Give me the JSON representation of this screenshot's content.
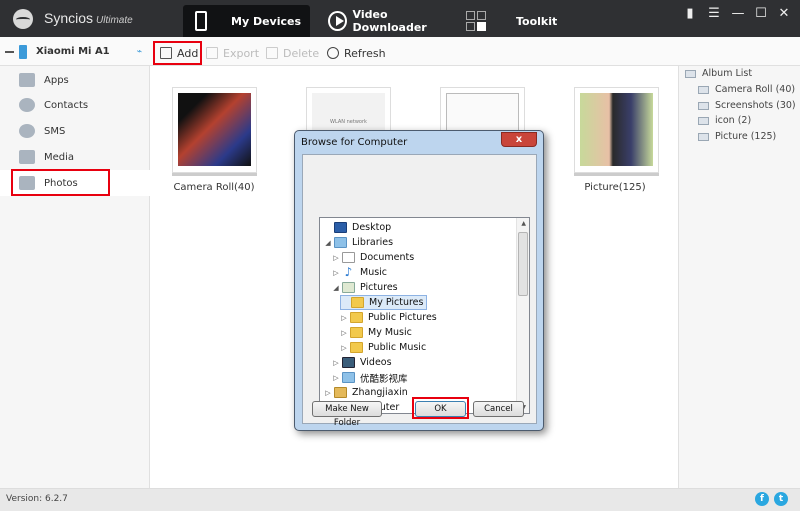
{
  "app": {
    "name": "Syncios",
    "edition": "Ultimate"
  },
  "nav_tabs": [
    {
      "label": "My Devices",
      "icon": "phone-icon",
      "active": true
    },
    {
      "label": "Video Downloader",
      "icon": "play-icon",
      "active": false
    },
    {
      "label": "Toolkit",
      "icon": "toolkit-grid-icon",
      "active": false
    }
  ],
  "window_controls": {
    "feedback": "▮",
    "menu": "☰",
    "minimize": "—",
    "maximize": "☐",
    "close": "✕"
  },
  "device": {
    "name": "Xiaomi Mi A1",
    "usb_icon": "⌁"
  },
  "toolbar": {
    "add": "Add",
    "export": "Export",
    "delete": "Delete",
    "refresh": "Refresh"
  },
  "sidebar": {
    "items": [
      {
        "label": "Apps",
        "icon": "apps-icon"
      },
      {
        "label": "Contacts",
        "icon": "contacts-icon"
      },
      {
        "label": "SMS",
        "icon": "sms-icon"
      },
      {
        "label": "Media",
        "icon": "media-icon"
      },
      {
        "label": "Photos",
        "icon": "photos-icon",
        "active": true
      }
    ]
  },
  "albums": [
    {
      "label": "Camera Roll(40)"
    },
    {
      "label": ""
    },
    {
      "label": ""
    },
    {
      "label": "Picture(125)"
    }
  ],
  "album_thumb_text": {
    "wlan": "WLAN network"
  },
  "album_list": {
    "title": "Album List",
    "items": [
      "Camera Roll (40)",
      "Screenshots (30)",
      "icon (2)",
      "Picture (125)"
    ]
  },
  "dialog": {
    "title": "Browse for Computer",
    "close": "x",
    "tree": [
      {
        "label": "Desktop",
        "level": 0,
        "icon": "desk",
        "expander": ""
      },
      {
        "label": "Libraries",
        "level": 0,
        "icon": "lib",
        "expander": "◢"
      },
      {
        "label": "Documents",
        "level": 1,
        "icon": "doc",
        "expander": "▷"
      },
      {
        "label": "Music",
        "level": 1,
        "icon": "music",
        "expander": "▷"
      },
      {
        "label": "Pictures",
        "level": 1,
        "icon": "pic",
        "expander": "◢"
      },
      {
        "label": "My Pictures",
        "level": 2,
        "icon": "folder",
        "expander": "",
        "selected": true
      },
      {
        "label": "Public Pictures",
        "level": 2,
        "icon": "folder",
        "expander": "▷"
      },
      {
        "label": "My Music",
        "level": 2,
        "icon": "folder",
        "expander": "▷"
      },
      {
        "label": "Public Music",
        "level": 2,
        "icon": "folder",
        "expander": "▷"
      },
      {
        "label": "Videos",
        "level": 1,
        "icon": "vid",
        "expander": "▷"
      },
      {
        "label": "优酷影视库",
        "level": 1,
        "icon": "lib",
        "expander": "▷"
      },
      {
        "label": "Zhangjiaxin",
        "level": 0,
        "icon": "user",
        "expander": "▷"
      },
      {
        "label": "Computer",
        "level": 0,
        "icon": "comp",
        "expander": "▷"
      }
    ],
    "buttons": {
      "new_folder": "Make New Folder",
      "ok": "OK",
      "cancel": "Cancel"
    }
  },
  "status": {
    "version": "Version: 6.2.7",
    "facebook": "f",
    "twitter": "t"
  }
}
